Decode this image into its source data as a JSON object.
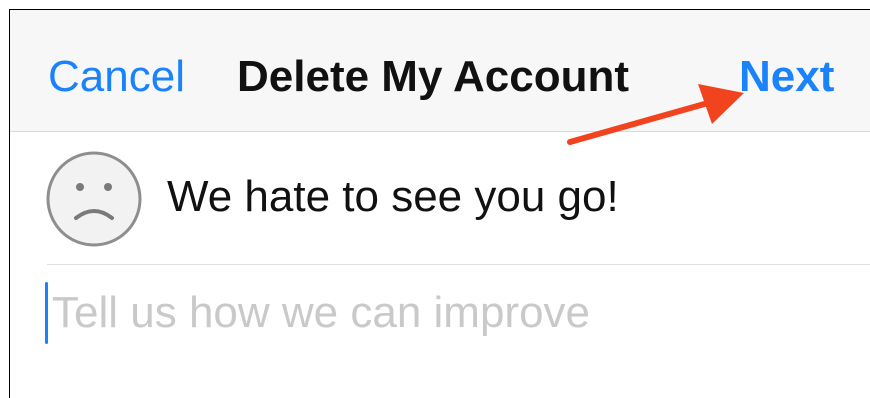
{
  "navbar": {
    "cancel_label": "Cancel",
    "title": "Delete My Account",
    "next_label": "Next",
    "accent_color": "#1a82fb"
  },
  "prompt": {
    "icon": "sad-face-icon",
    "message": "We hate to see you go!"
  },
  "feedback": {
    "value": "",
    "placeholder": "Tell us how we can improve"
  },
  "annotation": {
    "icon": "red-arrow-icon",
    "color": "#f2431f"
  }
}
